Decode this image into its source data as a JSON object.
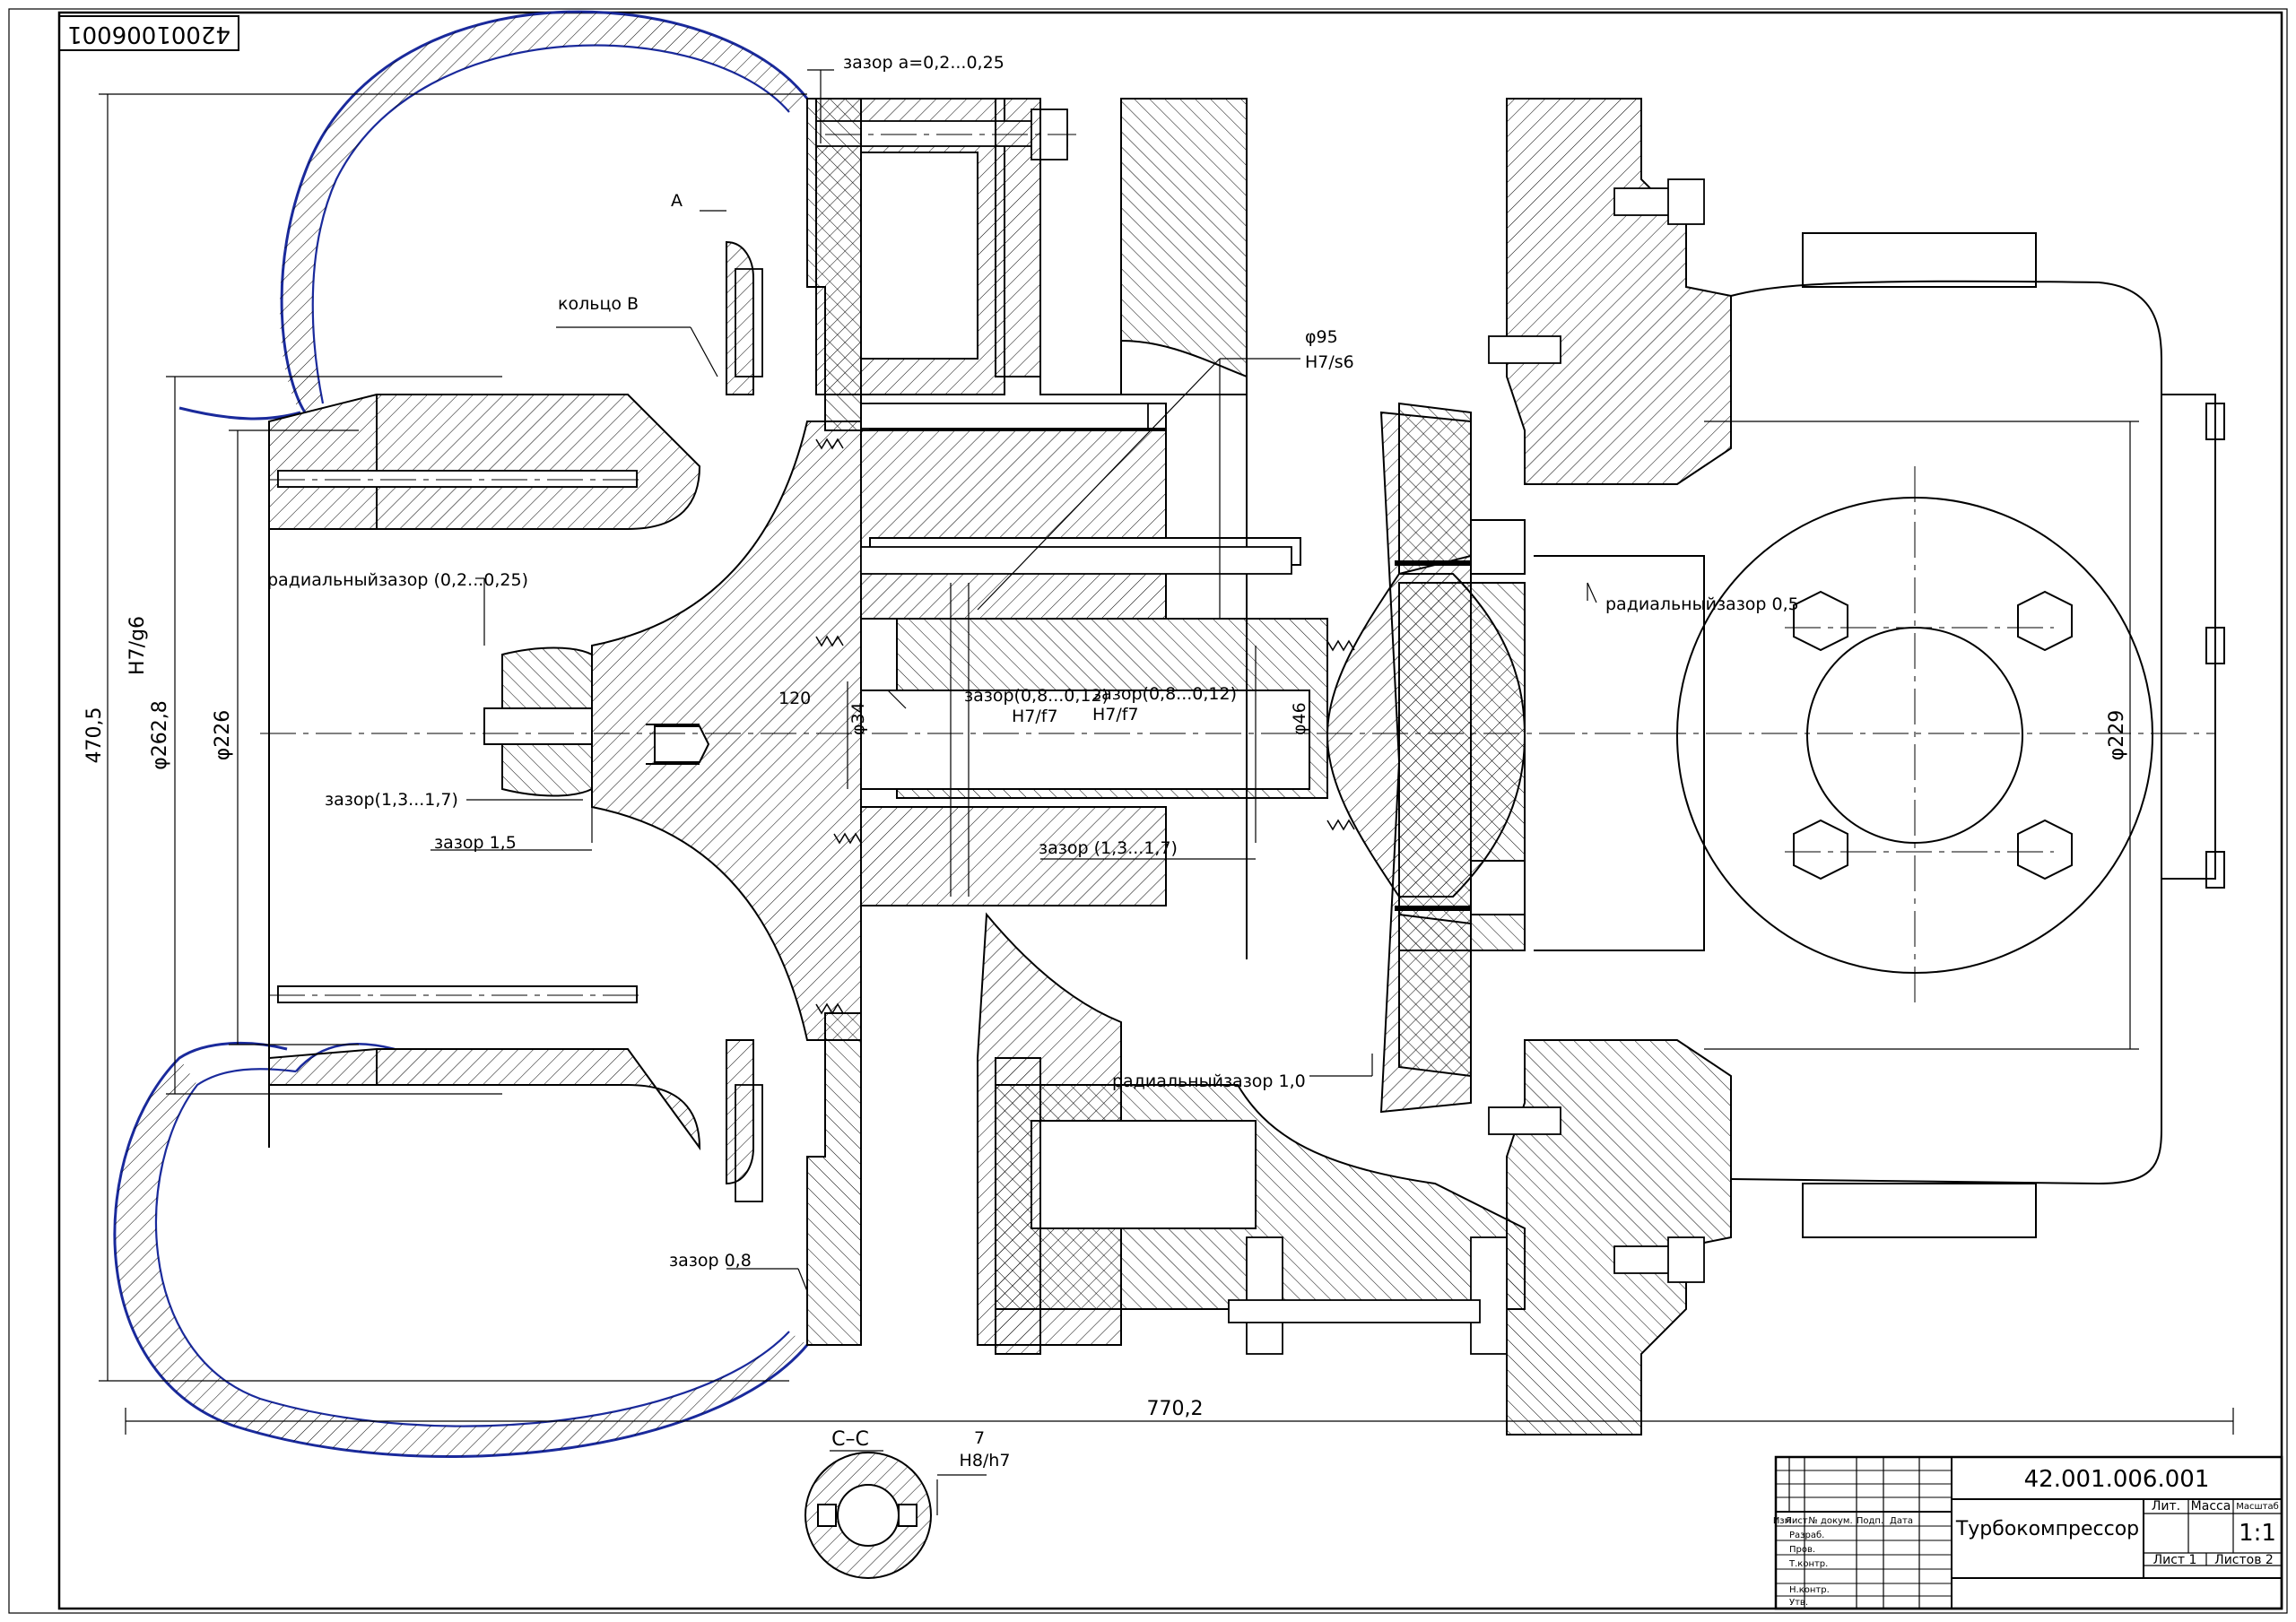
{
  "stamp": {
    "code_rotated": "42001006001"
  },
  "labels": {
    "gap_a": "зазор а=0,2...0,25",
    "section_mark": "А",
    "ring_b": "кольцо В",
    "phi95": "φ95",
    "fit_h7s6": "H7/s6",
    "radial_gap_top_left": "радиальныйзазор (0,2...0,25)",
    "radial_gap_right": "радиальныйзазор 0,5",
    "angle_120": "120",
    "gap_08_012_a": "зазор(0,8...0,12)",
    "fit_h7f7_a": "H7/f7",
    "gap_08_012_b": "зазор(0,8...0,12)",
    "fit_h7f7_b": "H7/f7",
    "phi34": "φ34",
    "phi46": "φ46",
    "gap_13_17_left": "зазор(1,3...1,7)",
    "gap_15": "зазор 1,5",
    "gap_13_17_mid": "зазор (1,3...1,7)",
    "radial_gap_10": "радиальныйзазор 1,0",
    "gap_08": "зазор 0,8",
    "dim_4705": "470,5",
    "fit_h7g6": "H7/g6",
    "dim_2628": "φ262,8",
    "dim_226": "φ226",
    "dim_229": "φ229",
    "dim_7702": "770,2",
    "section_cc": "С–С",
    "key_width": "7",
    "fit_h8h7": "H8/h7"
  },
  "title_block": {
    "doc_number": "42.001.006.001",
    "name": "Турбокомпрессор",
    "col_lit": "Лит.",
    "col_mass": "Масса",
    "col_scale": "Масштаб",
    "scale_value": "1:1",
    "sheet": "Лист 1",
    "sheets": "Листов 2",
    "hdr_izm": "Изм",
    "hdr_list": "Лист",
    "hdr_doc": "№ докум.",
    "hdr_sign": "Подп.",
    "hdr_date": "Дата",
    "role_razrab": "Разраб.",
    "role_prov": "Пров.",
    "role_tkontr": "Т.контр.",
    "role_nkontr": "Н.контр.",
    "role_utv": "Утв."
  },
  "colors": {
    "line": "#000000",
    "volute_outline": "#1a2a9c",
    "background": "#ffffff"
  }
}
